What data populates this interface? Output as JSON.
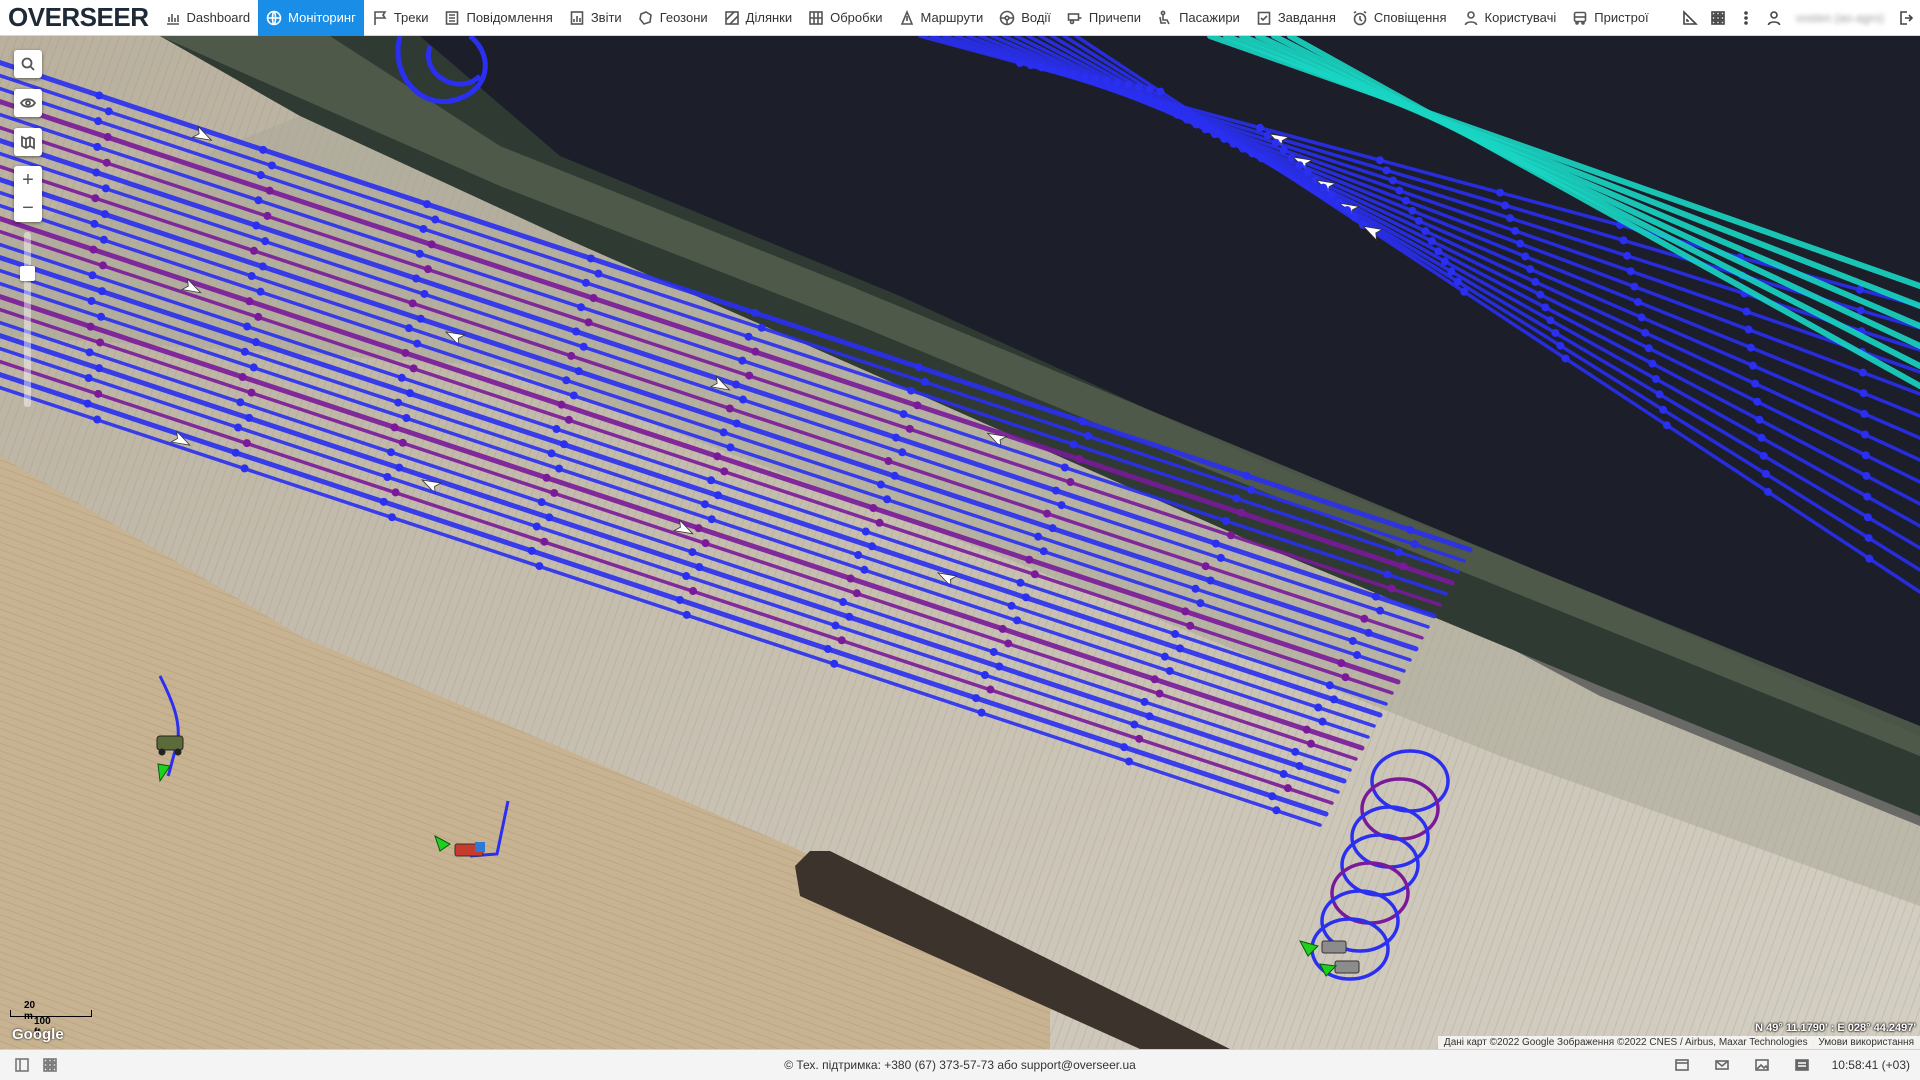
{
  "app": {
    "logo": "OVERSEER"
  },
  "nav": [
    {
      "label": "Dashboard",
      "icon": "chart-icon"
    },
    {
      "label": "Моніторинг",
      "icon": "globe-icon",
      "active": true
    },
    {
      "label": "Треки",
      "icon": "flag-icon"
    },
    {
      "label": "Повідомлення",
      "icon": "list-icon"
    },
    {
      "label": "Звіти",
      "icon": "report-icon"
    },
    {
      "label": "Геозони",
      "icon": "geozone-icon"
    },
    {
      "label": "Ділянки",
      "icon": "field-icon"
    },
    {
      "label": "Обробки",
      "icon": "processing-icon"
    },
    {
      "label": "Маршрути",
      "icon": "route-icon"
    },
    {
      "label": "Водії",
      "icon": "steering-wheel-icon"
    },
    {
      "label": "Причепи",
      "icon": "trailer-icon"
    },
    {
      "label": "Пасажири",
      "icon": "passenger-icon"
    },
    {
      "label": "Завдання",
      "icon": "task-icon"
    },
    {
      "label": "Сповіщення",
      "icon": "alarm-icon"
    },
    {
      "label": "Користувачі",
      "icon": "user-icon"
    },
    {
      "label": "Пристрої",
      "icon": "bus-icon"
    }
  ],
  "user": {
    "name": "vosten (ao-agro)"
  },
  "map": {
    "scale_metric": "20 m",
    "scale_imperial": "100 ft",
    "provider": "Google",
    "coords": "N 49° 11.1790' : E 028° 44.2497'",
    "attribution": "Дані карт ©2022 Google Зображення ©2022 CNES / Airbus, Maxar Technologies",
    "terms": "Умови використання"
  },
  "footer": {
    "support": "© Тех. підтримка: +380 (67) 373-57-73 або support@overseer.ua",
    "clock": "10:58:41 (+03)"
  },
  "colors": {
    "accent": "#1a8ee6",
    "track_blue": "#2a2ff0",
    "track_purple": "#7a1a9a",
    "track_cyan": "#19d6c4"
  }
}
